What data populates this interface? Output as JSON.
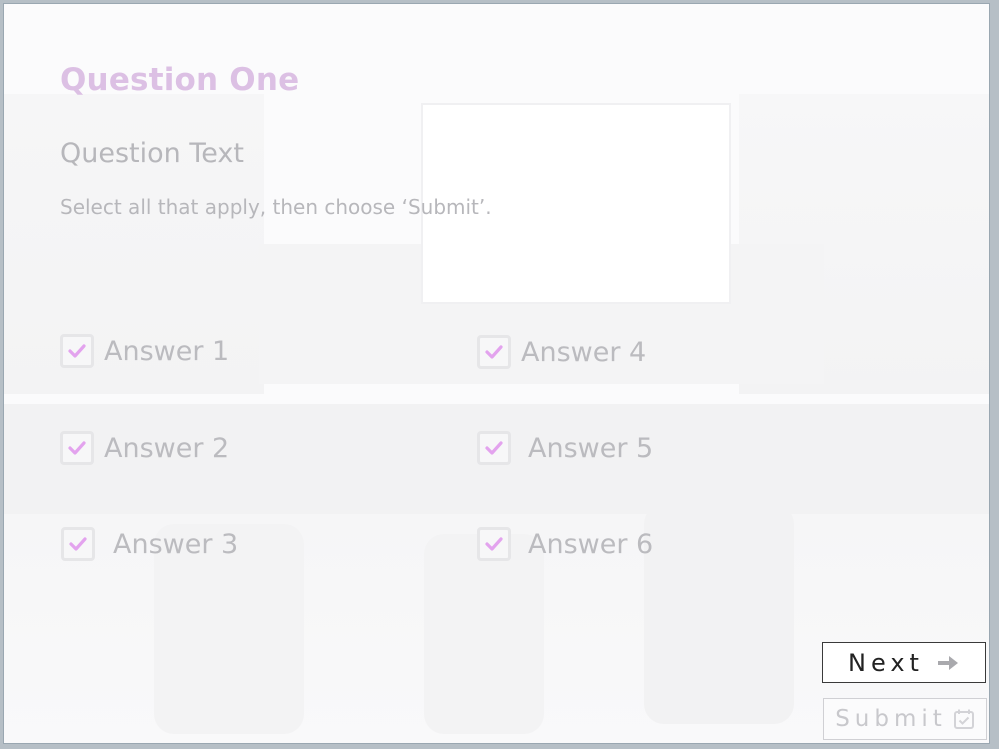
{
  "question": {
    "title": "Question One",
    "text": "Question Text",
    "instructions": "Select all that apply, then choose ‘Submit’."
  },
  "options": [
    {
      "label": "Answer 1",
      "checked": true
    },
    {
      "label": "Answer 2",
      "checked": true
    },
    {
      "label": "Answer 3",
      "checked": true
    },
    {
      "label": "Answer 4",
      "checked": true
    },
    {
      "label": "Answer 5",
      "checked": true
    },
    {
      "label": "Answer 6",
      "checked": true
    }
  ],
  "buttons": {
    "next_label": "Next",
    "next_icon": "arrow-right-icon",
    "submit_label": "Submit",
    "submit_icon": "calendar-check-icon",
    "submit_enabled": false
  },
  "colors": {
    "title": "#dcc0e4",
    "checkmark": "#e3a3ee",
    "text_faded": "#b7b7bb",
    "next_border": "#3a3a3a"
  }
}
